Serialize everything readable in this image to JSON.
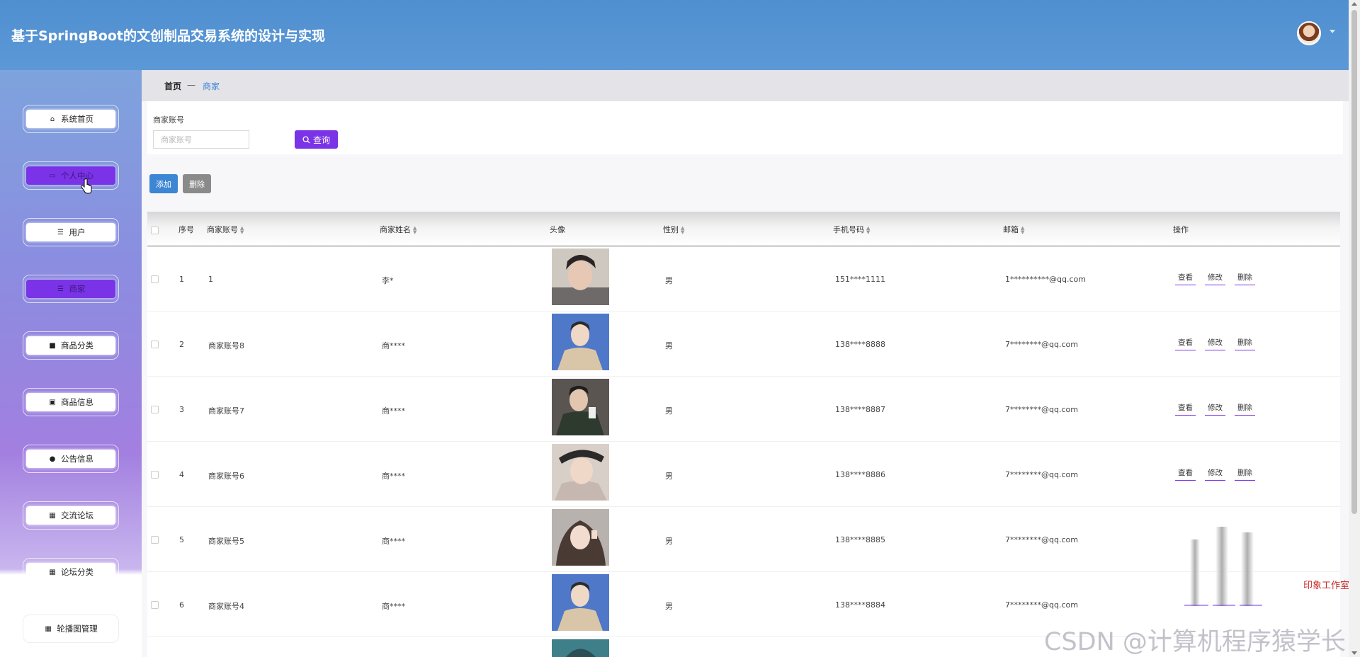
{
  "header": {
    "title": "基于SpringBoot的文创制品交易系统的设计与实现"
  },
  "sidebar": {
    "items": [
      {
        "label": "系统首页",
        "icon": "home-icon"
      },
      {
        "label": "个人中心",
        "icon": "profile-card-icon"
      },
      {
        "label": "用户",
        "icon": "list-icon"
      },
      {
        "label": "商家",
        "icon": "list-icon"
      },
      {
        "label": "商品分类",
        "icon": "chart-icon"
      },
      {
        "label": "商品信息",
        "icon": "clipboard-icon"
      },
      {
        "label": "公告信息",
        "icon": "user-icon"
      },
      {
        "label": "交流论坛",
        "icon": "grid-icon"
      },
      {
        "label": "论坛分类",
        "icon": "grid-icon"
      },
      {
        "label": "轮播图管理",
        "icon": "grid-icon"
      }
    ]
  },
  "breadcrumb": {
    "home": "首页",
    "separator": "—",
    "current": "商家"
  },
  "search": {
    "label": "商家账号",
    "placeholder": "商家账号",
    "button": "查询"
  },
  "actions": {
    "add": "添加",
    "delete": "删除"
  },
  "table": {
    "headers": {
      "index": "序号",
      "account": "商家账号",
      "name": "商家姓名",
      "avatar": "头像",
      "gender": "性别",
      "phone": "手机号码",
      "email": "邮箱",
      "ops": "操作"
    },
    "op_labels": {
      "view": "查看",
      "edit": "修改",
      "delete": "删除"
    },
    "rows": [
      {
        "index": "1",
        "account": "1",
        "name": "李*",
        "gender": "男",
        "phone": "151****1111",
        "email": "1**********@qq.com"
      },
      {
        "index": "2",
        "account": "商家账号8",
        "name": "商****",
        "gender": "男",
        "phone": "138****8888",
        "email": "7********@qq.com"
      },
      {
        "index": "3",
        "account": "商家账号7",
        "name": "商****",
        "gender": "男",
        "phone": "138****8887",
        "email": "7********@qq.com"
      },
      {
        "index": "4",
        "account": "商家账号6",
        "name": "商****",
        "gender": "男",
        "phone": "138****8886",
        "email": "7********@qq.com"
      },
      {
        "index": "5",
        "account": "商家账号5",
        "name": "商****",
        "gender": "男",
        "phone": "138****8885",
        "email": "7********@qq.com"
      },
      {
        "index": "6",
        "account": "商家账号4",
        "name": "商****",
        "gender": "男",
        "phone": "138****8884",
        "email": "7********@qq.com"
      }
    ]
  },
  "watermark": "CSDN @计算机程序猿学长",
  "side_note": "印象工作室",
  "colors": {
    "header": "#5592d3",
    "accent_purple": "#7a33e6",
    "add_button": "#3c86d4",
    "delete_button": "#8a8a8a",
    "breadcrumb_link": "#3d82d9"
  }
}
